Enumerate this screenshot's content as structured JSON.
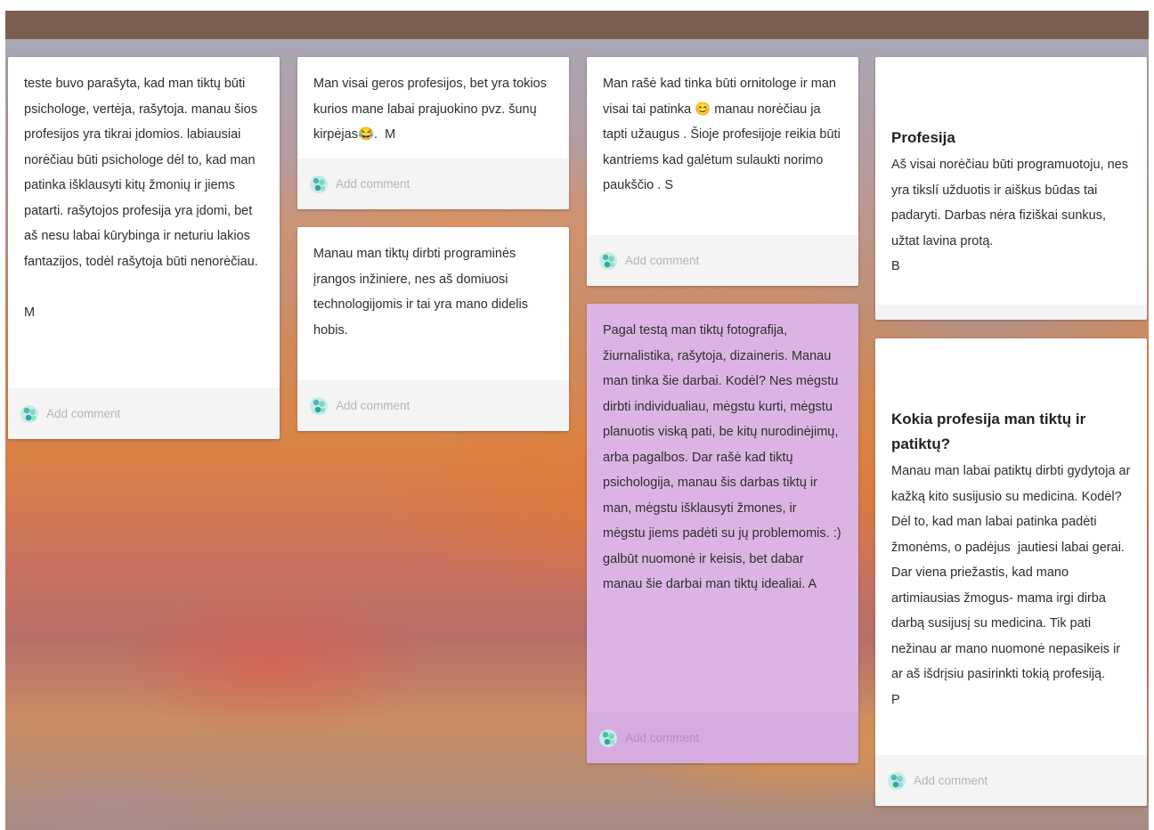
{
  "add_comment_label": "Add comment",
  "colors": {
    "top_bar": "#7a5f50",
    "card": "#ffffff",
    "card_highlight": "#dcb4e4",
    "comment_bar": "#f4f4f4"
  },
  "posts": [
    {
      "title": "",
      "body": "teste buvo parašyta, kad man tiktų būti psichologe, vertėja, rašytoja. manau šios profesijos yra tikrai įdomios. labiausiai norėčiau būti psichologe dėl to, kad man patinka išklausyti kitų žmonių ir jiems patarti. rašytojos profesija yra įdomi, bet aš nesu labai kūrybinga ir neturiu lakios fantazijos, todėl rašytoja būti nenorėčiau.\n\nM"
    },
    {
      "title": "",
      "body": "Man visai geros profesijos, bet yra tokios kurios mane labai prajuokino pvz. šunų kirpėjas😂.  M"
    },
    {
      "title": "",
      "body": "Manau man tiktų dirbti programinės įrangos inžiniere, nes aš domiuosi technologijomis ir tai yra mano didelis hobis."
    },
    {
      "title": "",
      "body": "Man rašė kad tinka būti ornitologe ir man visai tai patinka 😊 manau norėčiau ja tapti užaugus . Šioje profesijoje reikia būti kantriems kad galėtum sulaukti norimo paukščio . S"
    },
    {
      "title": "",
      "body": "Pagal testą man tiktų fotografija, žiurnalistika, rašytoja, dizaineris. Manau man tinka šie darbai. Kodėl? Nes mėgstu dirbti individualiau, mėgstu kurti, mėgstu planuotis viską pati, be kitų nurodinėjimų, arba pagalbos. Dar rašė kad tiktų psichologija, manau šis darbas tiktų ir man, mėgstu išklausyti žmones, ir mėgstu jiems padėti su jų problemomis. :) galbūt nuomonė ir keisis, bet dabar manau šie darbai man tiktų idealiai. A"
    },
    {
      "title": "Profesija",
      "body": "Aš visai norėčiau būti programuotoju, nes yra tikslí užduotis ir aiškus būdas tai padaryti. Darbas nėra fiziškai sunkus, užtat lavina protą.\nB"
    },
    {
      "title": "Kokia profesija man tiktų ir patiktų?",
      "body": "Manau man labai patiktų dirbti gydytoja ar kažką kito susijusio su medicina. Kodėl? Dėl to, kad man labai patinka padėti žmonėms, o padėjus  jautiesi labai gerai. Dar viena priežastis, kad mano artimiausias žmogus- mama irgi dirba darbą susijusį su medicina. Tik pati nežinau ar mano nuomonė nepasikeis ir ar aš išdrįsiu pasirinkti tokią profesiją.\nP"
    }
  ]
}
